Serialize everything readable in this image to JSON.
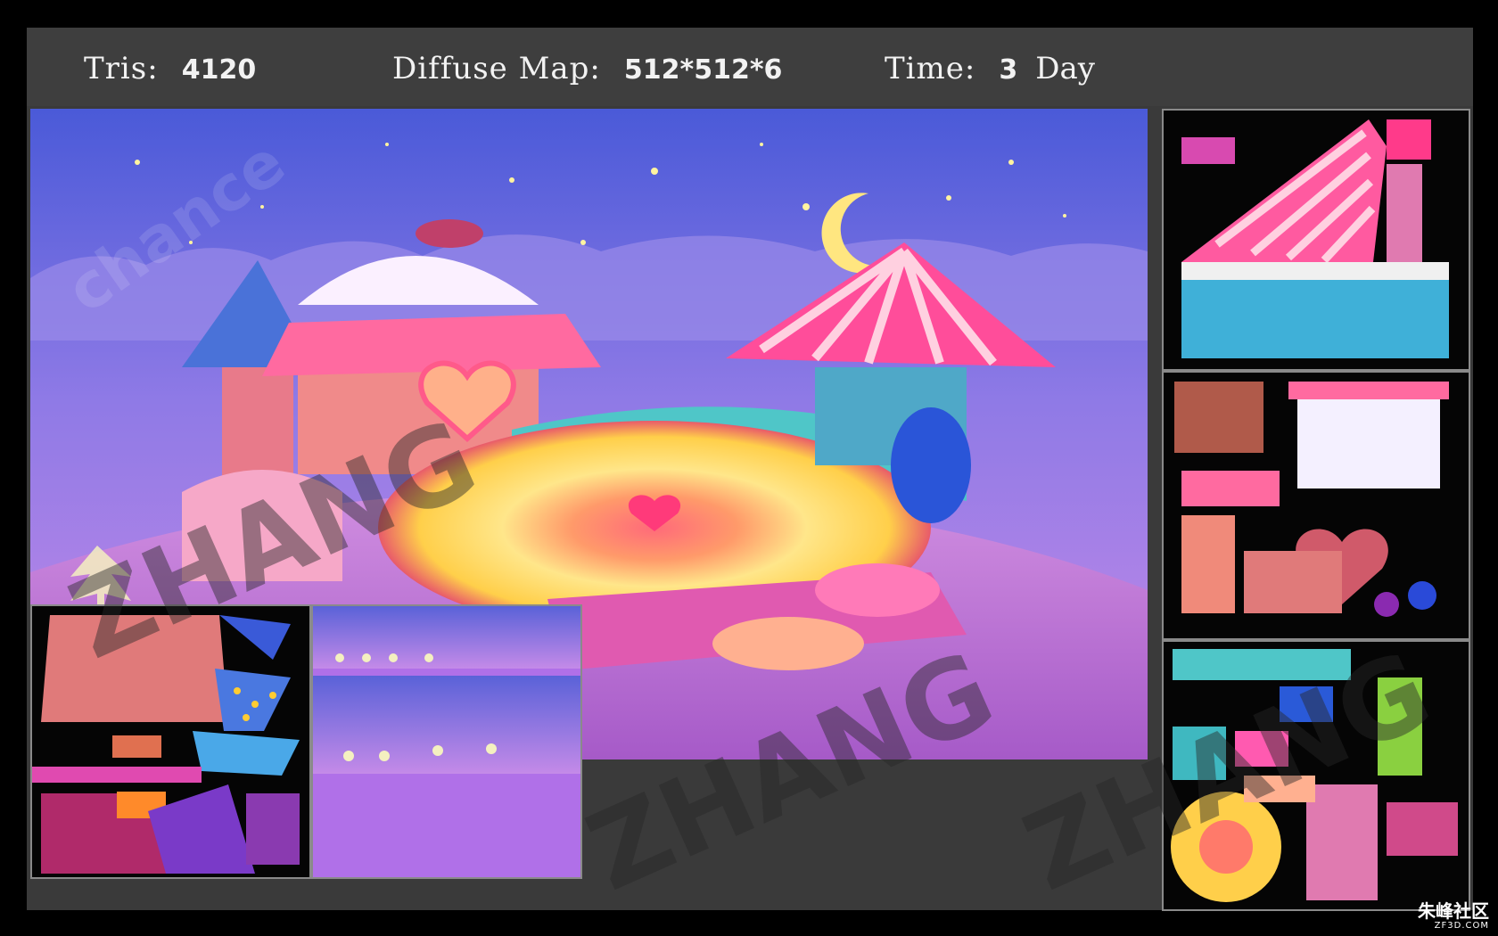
{
  "header": {
    "tris_label": "Tris:",
    "tris_value": "4120",
    "diffuse_label": "Diffuse Map:",
    "diffuse_value": "512*512*6",
    "time_label": "Time:",
    "time_value": "3",
    "time_unit": "Day"
  },
  "watermark": {
    "main": "ZHANG",
    "faint": "chance"
  },
  "logo": {
    "name": "朱峰社区",
    "url": "ZF3D.COM"
  },
  "colors": {
    "frame": "#3a3a3a",
    "header": "#3e3e3e",
    "sky_top": "#5a6fe0",
    "sky_bottom": "#b77ee6",
    "ground": "#c07ad8",
    "pink_stripe": "#ff4d9a",
    "teal": "#4fc6c8",
    "gold": "#ffd84a"
  },
  "icons": [
    "moon-icon",
    "star-icon",
    "heart-icon"
  ]
}
